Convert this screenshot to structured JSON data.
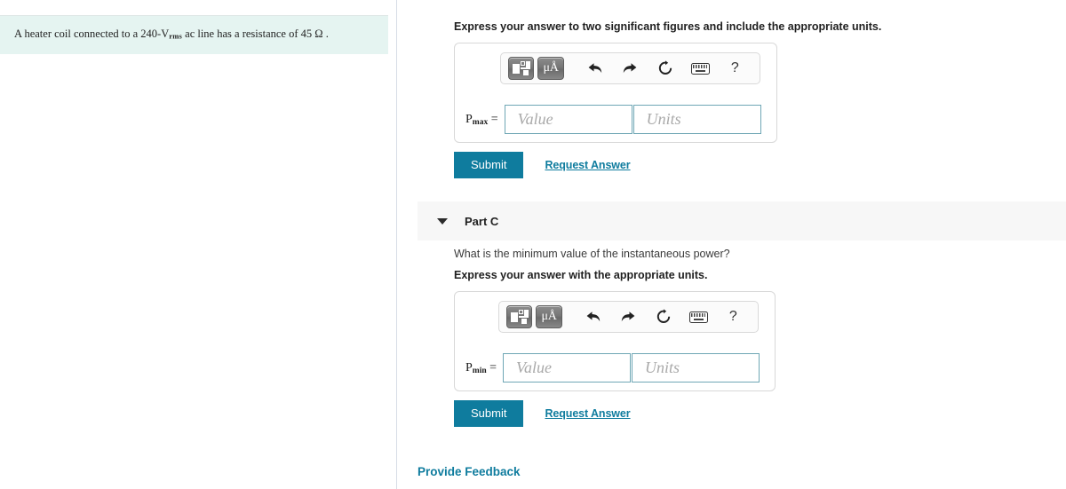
{
  "problem": {
    "text_before": "A heater coil connected to a 240-",
    "unit_symbol": "V",
    "unit_subscript": "rms",
    "text_after": " ac line has a resistance of 45 ",
    "ohm": "Ω",
    "period": "."
  },
  "part_b": {
    "instruction": "Express your answer to two significant figures and include the appropriate units.",
    "answer": {
      "label_base": "P",
      "label_sub": "max",
      "equals": "=",
      "value_placeholder": "Value",
      "units_placeholder": "Units",
      "value": "",
      "units": ""
    },
    "submit_label": "Submit",
    "request_answer_label": "Request Answer"
  },
  "part_c": {
    "title": "Part C",
    "question": "What is the minimum value of the instantaneous power?",
    "instruction": "Express your answer with the appropriate units.",
    "answer": {
      "label_base": "P",
      "label_sub": "min",
      "equals": "=",
      "value_placeholder": "Value",
      "units_placeholder": "Units",
      "value": "",
      "units": ""
    },
    "submit_label": "Submit",
    "request_answer_label": "Request Answer"
  },
  "toolbar": {
    "template_icon": "template-layout-icon",
    "units_label": "μÅ",
    "undo_icon": "undo-arrow-icon",
    "redo_icon": "redo-arrow-icon",
    "reset_icon": "reset-circular-arrow-icon",
    "keyboard_icon": "keyboard-icon",
    "help_label": "?"
  },
  "footer": {
    "feedback_label": "Provide Feedback"
  },
  "colors": {
    "accent": "#0f7c9e",
    "problem_bg": "#e5f4f1",
    "part_header_bg": "#f7f7f7",
    "field_border": "#6fa7b5"
  }
}
